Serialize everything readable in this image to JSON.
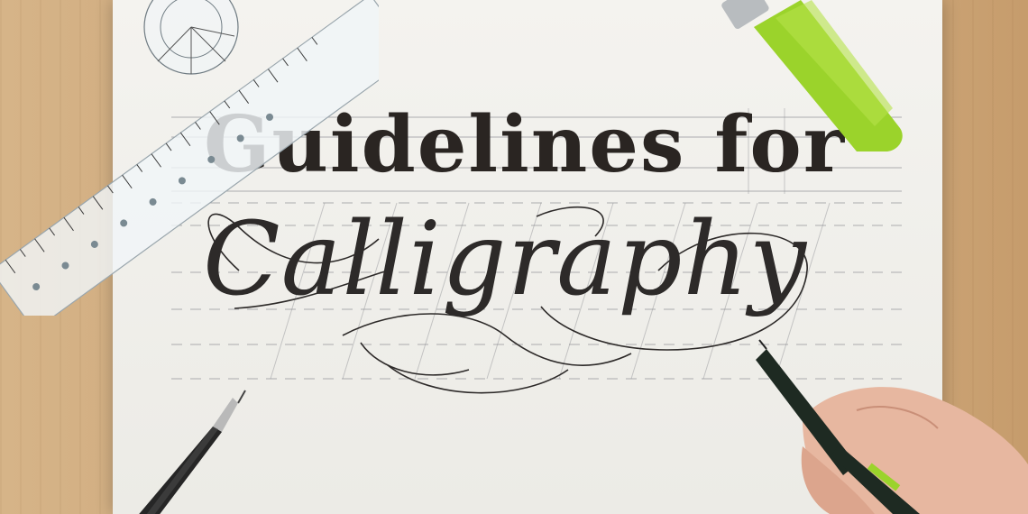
{
  "image": {
    "subject": "Calligraphy worksheet",
    "headline": {
      "line1": "Guidelines for",
      "line2": "Calligraphy"
    }
  },
  "colors": {
    "desk": "#caa478",
    "paper": "#f0efea",
    "ink": "#2a2522",
    "guideline": "#8f9095",
    "highlighter": "#9bd32b"
  },
  "props": {
    "ruler_icon": "ruler-icon",
    "protractor_icon": "protractor-icon",
    "pencil_icon": "pencil-icon",
    "pen_icon": "pen-icon",
    "marker_icon": "marker-icon",
    "hand_icon": "hand-icon"
  }
}
